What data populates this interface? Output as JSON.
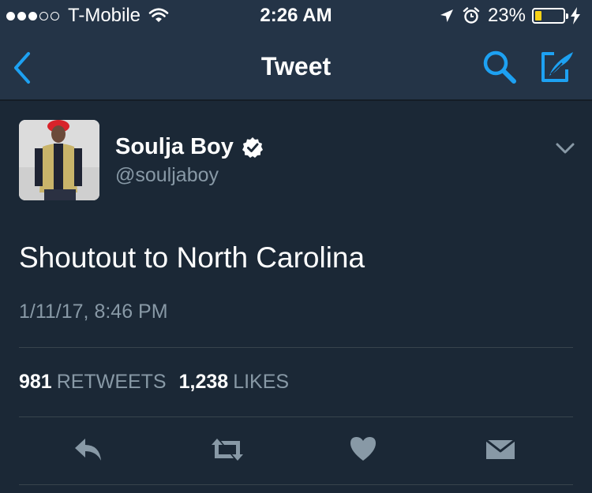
{
  "status_bar": {
    "carrier": "T-Mobile",
    "signal_bars": 3,
    "signal_total": 5,
    "time": "2:26 AM",
    "battery_percent": "23%",
    "battery_level": 0.23,
    "icons": [
      "wifi-icon",
      "location-arrow-icon",
      "alarm-icon",
      "battery-icon",
      "charging-bolt-icon"
    ]
  },
  "nav": {
    "title": "Tweet",
    "back_icon": "chevron-left-icon",
    "search_icon": "search-icon",
    "compose_icon": "compose-icon"
  },
  "tweet": {
    "author_name": "Soulja Boy",
    "verified": true,
    "author_handle": "@souljaboy",
    "text": "Shoutout to North Carolina",
    "timestamp": "1/11/17, 8:46 PM",
    "retweets_count": "981",
    "retweets_label": "RETWEETS",
    "likes_count": "1,238",
    "likes_label": "LIKES"
  },
  "actions": [
    "reply-icon",
    "retweet-icon",
    "like-icon",
    "direct-message-icon"
  ],
  "colors": {
    "background": "#1b2836",
    "header": "#243447",
    "accent": "#1da1f2",
    "secondary_text": "#8899a6",
    "battery": "#f7d217"
  }
}
